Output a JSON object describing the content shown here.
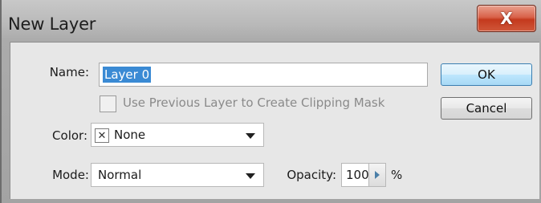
{
  "window": {
    "title": "New Layer",
    "close_icon": "close-icon",
    "close_glyph": "X"
  },
  "form": {
    "name_label": "Name:",
    "name_value": "Layer 0",
    "clipping_checkbox_label": "Use Previous Layer to Create Clipping Mask",
    "clipping_checked": false,
    "color_label": "Color:",
    "color_swatch_glyph": "✕",
    "color_value": "None",
    "mode_label": "Mode:",
    "mode_value": "Normal",
    "opacity_label": "Opacity:",
    "opacity_value": "100",
    "opacity_unit": "%"
  },
  "buttons": {
    "ok_label": "OK",
    "cancel_label": "Cancel"
  },
  "colors": {
    "selection": "#3a8ad4",
    "close_button": "#c4391d",
    "ok_accent": "#bee6fd"
  }
}
